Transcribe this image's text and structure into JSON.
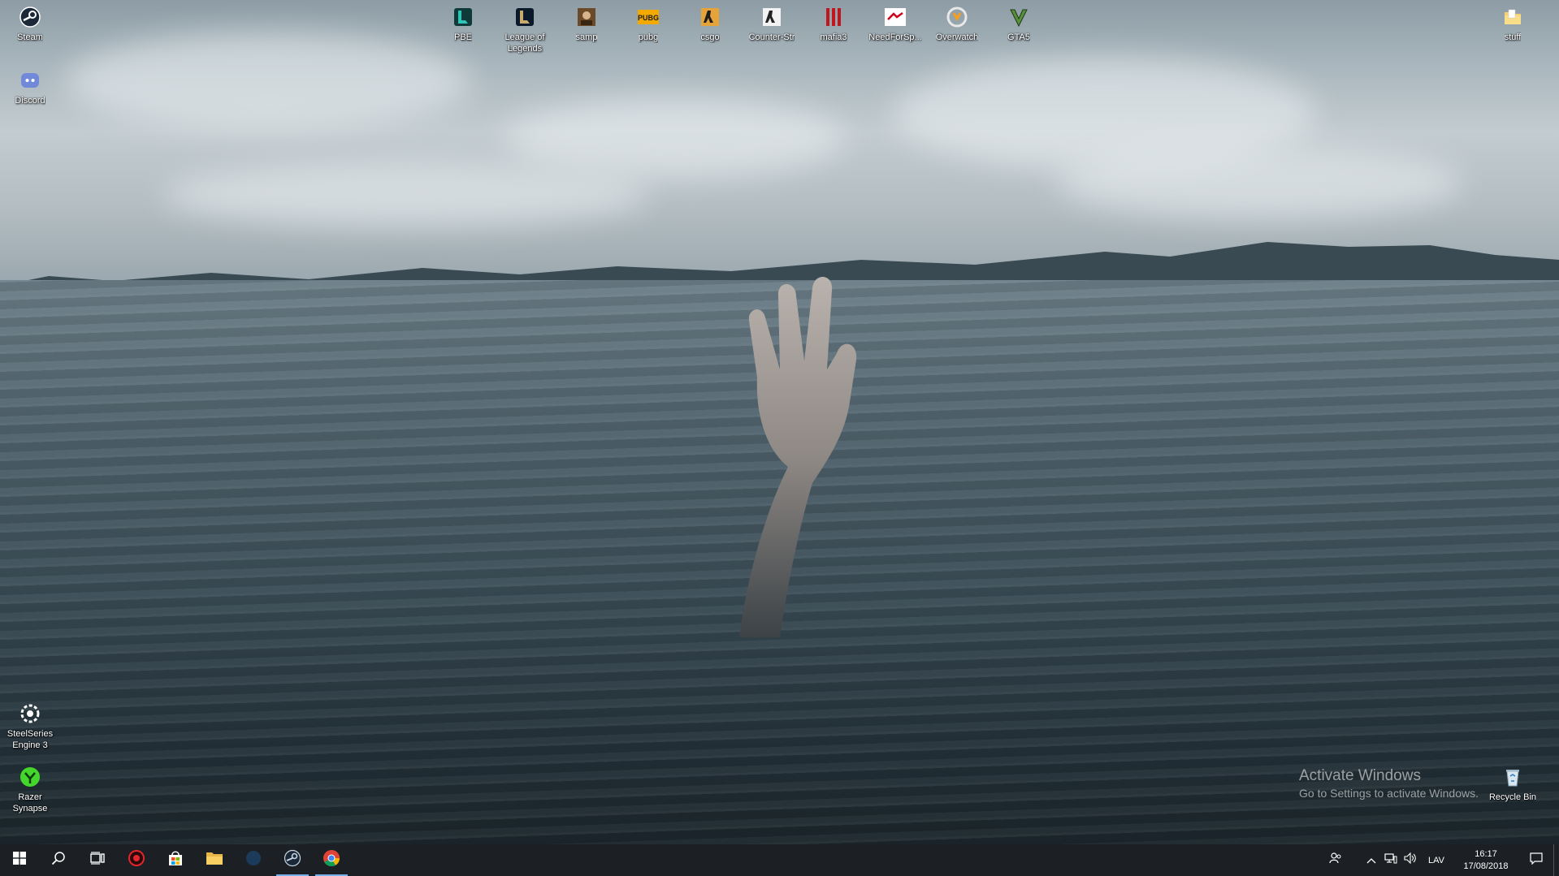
{
  "desktop": {
    "left_icons": [
      {
        "label": "Steam",
        "icon": "steam-icon"
      },
      {
        "label": "Discord",
        "icon": "discord-icon"
      },
      {
        "label": "SteelSeries Engine 3",
        "icon": "steelseries-icon"
      },
      {
        "label": "Razer Synapse",
        "icon": "razer-icon"
      }
    ],
    "top_icons": [
      {
        "label": "PBE",
        "icon": "pbe-icon"
      },
      {
        "label": "League of Legends",
        "icon": "league-icon"
      },
      {
        "label": "samp",
        "icon": "samp-icon"
      },
      {
        "label": "pubg",
        "icon": "pubg-icon"
      },
      {
        "label": "csgo",
        "icon": "csgo-icon"
      },
      {
        "label": "Counter-Str",
        "icon": "counter-strike-icon"
      },
      {
        "label": "mafia3",
        "icon": "mafia3-icon"
      },
      {
        "label": "NeedForSp...",
        "icon": "need-for-speed-icon"
      },
      {
        "label": "Overwatch",
        "icon": "overwatch-icon"
      },
      {
        "label": "GTA5",
        "icon": "gta5-icon"
      }
    ],
    "right_icons": [
      {
        "label": "stuff",
        "icon": "folder-icon"
      },
      {
        "label": "Recycle Bin",
        "icon": "recycle-bin-icon"
      }
    ]
  },
  "watermark": {
    "line1": "Activate Windows",
    "line2": "Go to Settings to activate Windows."
  },
  "taskbar": {
    "pinned": [
      "start-icon",
      "search-icon",
      "task-view-icon",
      "razer-cortex-icon",
      "store-icon",
      "file-explorer-icon",
      "steelseries-app-icon",
      "steam-app-icon",
      "chrome-icon"
    ],
    "language": "LAV",
    "time": "16:17",
    "date": "17/08/2018"
  },
  "colors": {
    "taskbar": "#1c2024",
    "accent": "#7ab0e6"
  }
}
